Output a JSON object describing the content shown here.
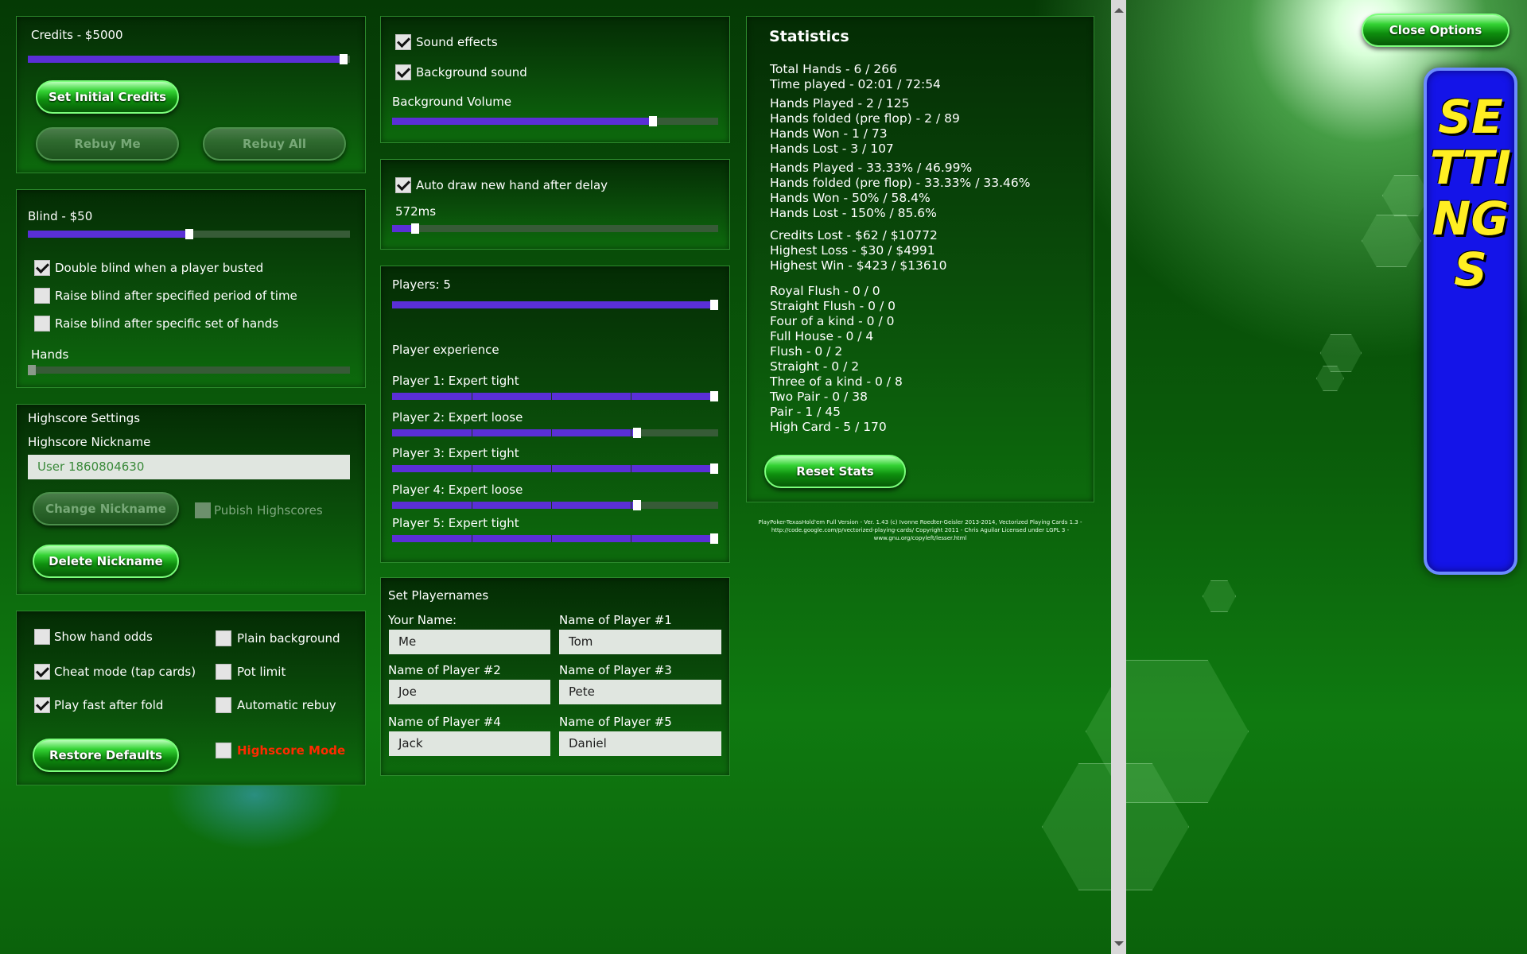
{
  "credits": {
    "label": "Credits - $5000",
    "value": 0.98,
    "set_initial": "Set Initial Credits",
    "rebuy_me": "Rebuy Me",
    "rebuy_all": "Rebuy All"
  },
  "blind": {
    "label": "Blind - $50",
    "value": 0.5,
    "double_blind": "Double blind when a player busted",
    "raise_time": "Raise blind after specified period of time",
    "raise_hands": "Raise blind after specific set of hands",
    "hands_label": "Hands",
    "hands_value": 0.0
  },
  "highscore": {
    "title": "Highscore Settings",
    "nickname_label": "Highscore Nickname",
    "nickname_value": "User 1860804630",
    "change_nickname": "Change Nickname",
    "publish": "Pubish Highscores",
    "delete_nickname": "Delete Nickname"
  },
  "options": {
    "show_hand_odds": "Show hand odds",
    "plain_background": "Plain background",
    "cheat_mode": "Cheat mode (tap cards)",
    "pot_limit": "Pot limit",
    "play_fast": "Play fast after fold",
    "automatic_rebuy": "Automatic rebuy",
    "restore_defaults": "Restore Defaults",
    "highscore_mode": "Highscore Mode"
  },
  "sound": {
    "sound_effects": "Sound effects",
    "background_sound": "Background sound",
    "volume_label": "Background Volume",
    "volume_value": 0.8
  },
  "autodraw": {
    "label": "Auto draw new hand after delay",
    "delay_label": "572ms",
    "delay_value": 0.07
  },
  "players": {
    "label": "Players: 5",
    "count_value": 1.0,
    "experience_label": "Player experience",
    "list": [
      {
        "label": "Player 1: Expert tight",
        "value": 1.0
      },
      {
        "label": "Player 2: Expert loose",
        "value": 0.75
      },
      {
        "label": "Player 3: Expert tight",
        "value": 1.0
      },
      {
        "label": "Player 4: Expert loose",
        "value": 0.75
      },
      {
        "label": "Player 5: Expert tight",
        "value": 1.0
      }
    ]
  },
  "names": {
    "title": "Set Playernames",
    "your_name_label": "Your Name:",
    "your_name": "Me",
    "list": [
      {
        "label": "Name of Player #1",
        "value": "Tom"
      },
      {
        "label": "Name of Player #2",
        "value": "Joe"
      },
      {
        "label": "Name of Player #3",
        "value": "Pete"
      },
      {
        "label": "Name of Player #4",
        "value": "Jack"
      },
      {
        "label": "Name of Player #5",
        "value": "Daniel"
      }
    ]
  },
  "statistics": {
    "title": "Statistics",
    "lines": [
      "Total Hands - 6 / 266",
      "Time played - 02:01 / 72:54",
      "Hands Played - 2 / 125",
      "Hands folded (pre flop) - 2 / 89",
      "Hands Won - 1 / 73",
      "Hands Lost - 3 / 107",
      "Hands Played - 33.33% / 46.99%",
      "Hands folded (pre flop) - 33.33% / 33.46%",
      "Hands Won - 50% / 58.4%",
      "Hands Lost - 150% / 85.6%",
      "Credits Lost - $62 / $10772",
      "Highest Loss - $30 / $4991",
      "Highest Win - $423 / $13610",
      "Royal Flush - 0 / 0",
      "Straight Flush - 0 / 0",
      "Four of a kind - 0 / 0",
      "Full House - 0 / 4",
      "Flush - 0 / 2",
      "Straight - 0 / 2",
      "Three of a kind - 0 / 8",
      "Two Pair - 0 / 38",
      "Pair - 1 / 45",
      "High Card - 5 / 170"
    ],
    "reset": "Reset Stats"
  },
  "credits_footer": "PlayPoker-TexasHold'em Full Version - Ver. 1.43 (c) Ivonne Roedter-Geisler 2013-2014, Vectorized Playing Cards 1.3 - http://code.google.com/p/vectorized-playing-cards/ Copyright 2011 - Chris Aguilar Licensed under LGPL 3 - www.gnu.org/copyleft/lesser.html",
  "close_options": "Close Options",
  "settings_banner": "SETTINGS",
  "colors": {
    "slider_fill": "#5a2fd6",
    "highscore_mode": "#ff2a00",
    "banner": "#1414e8",
    "banner_text": "#ffee22"
  }
}
